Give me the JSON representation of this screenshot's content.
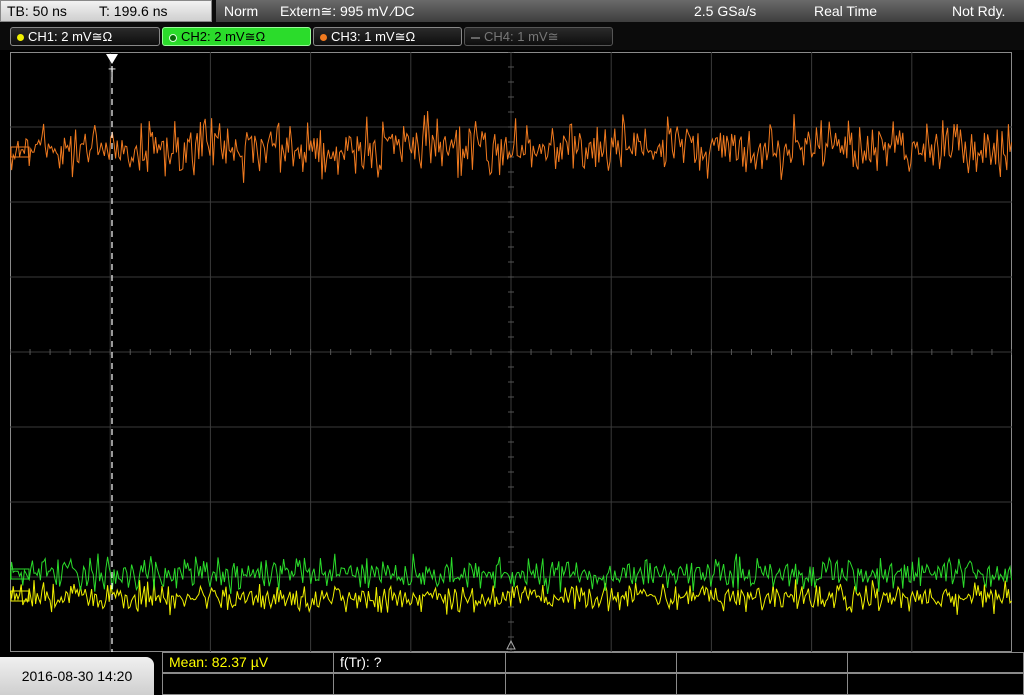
{
  "statusbar": {
    "timebase": "TB: 50 ns",
    "trigger_time": "T: 199.6 ns",
    "mode": "Norm",
    "trigger_source": "Extern≅: 995 mV ⁄DC",
    "sample_rate": "2.5 GSa/s",
    "acq_mode": "Real Time",
    "state": "Not Rdy."
  },
  "channels": [
    {
      "label": "CH1: 2 mV≅Ω",
      "color": "#f0f000",
      "state": "on"
    },
    {
      "label": "CH2: 2 mV≅Ω",
      "color": "#2bdc2b",
      "state": "active"
    },
    {
      "label": "CH3: 1 mV≅Ω",
      "color": "#f07a1f",
      "state": "on"
    },
    {
      "label": "CH4: 1 mV≅",
      "color": "#777777",
      "state": "off"
    }
  ],
  "trigger_marker": "T",
  "measurements": {
    "mean": "Mean: 82.37 µV",
    "freq": "f(Tr): ?"
  },
  "datetime": "2016-08-30 14:20",
  "colors": {
    "ch1": "#f0f000",
    "ch2": "#2bdc2b",
    "ch3": "#f07a1f",
    "grid": "#3a3a3a",
    "mean_label": "#ffff00"
  }
}
